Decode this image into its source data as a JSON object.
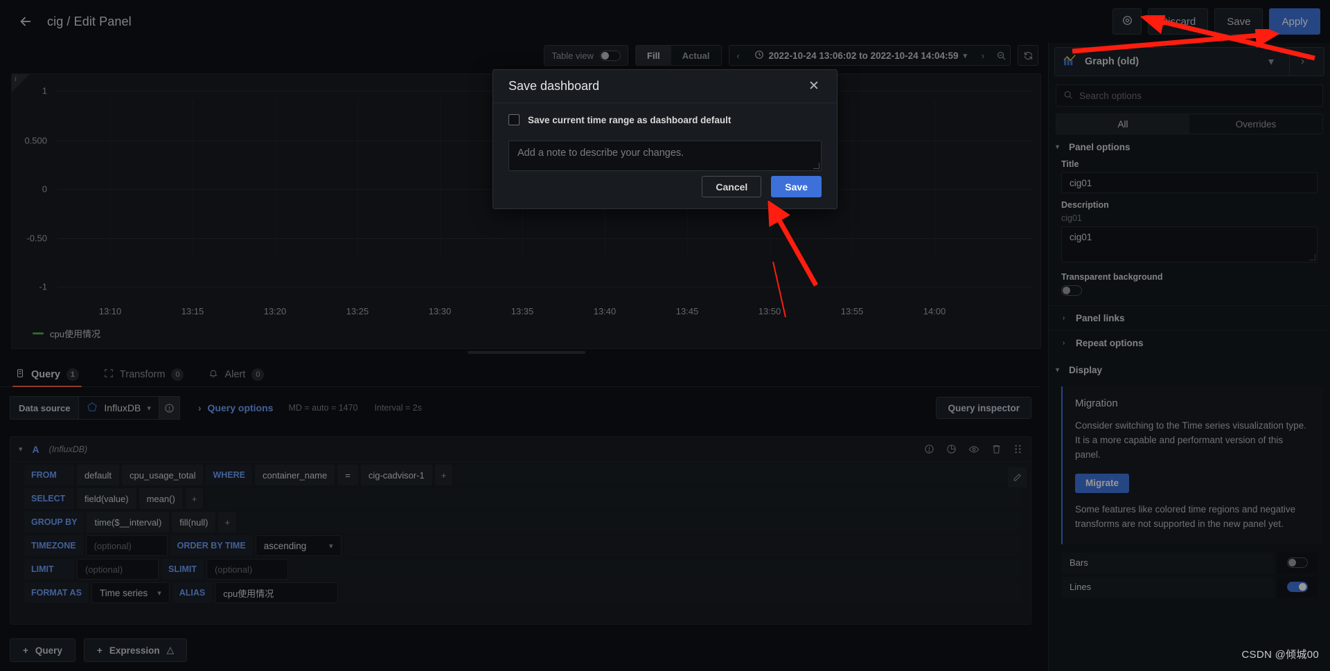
{
  "topbar": {
    "back_icon": "arrow-left-icon",
    "breadcrumb": "cig / Edit Panel",
    "settings_icon": "gear-icon",
    "discard_label": "Discard",
    "save_label": "Save",
    "apply_label": "Apply",
    "accent_primary": "#3d71d9"
  },
  "panel_toolbar": {
    "table_view_label": "Table view",
    "table_view_on": false,
    "fill_label": "Fill",
    "actual_label": "Actual",
    "active_scale": "Fill",
    "prev_icon": "chevron-left-icon",
    "clock_icon": "clock-icon",
    "time_range": "2022-10-24 13:06:02 to 2022-10-24 14:04:59",
    "caret_icon": "chevron-down-icon",
    "next_icon": "chevron-right-icon",
    "zoom_out_icon": "zoom-out-icon",
    "refresh_icon": "refresh-icon"
  },
  "graph": {
    "info_icon": "info-corner-icon",
    "resize_handle": "panel-resize-handle"
  },
  "chart_data": {
    "type": "line",
    "title": "",
    "xlabel": "",
    "ylabel": "",
    "series": [
      {
        "name": "cpu使用情况",
        "color": "#56a64b",
        "values": []
      }
    ],
    "x_ticks": [
      "13:10",
      "13:15",
      "13:20",
      "13:25",
      "13:30",
      "13:35",
      "13:40",
      "13:45",
      "13:50",
      "13:55",
      "14:00"
    ],
    "y_ticks": [
      "1",
      "0.500",
      "0",
      "-0.50",
      "-1"
    ],
    "ylim": [
      -1,
      1
    ],
    "grid": true,
    "legend_position": "bottom-left",
    "legend": [
      "cpu使用情况"
    ],
    "time_from": "2022-10-24 13:06:02",
    "time_to": "2022-10-24 14:04:59",
    "note": "No data points rendered in the plot area"
  },
  "editor_tabs": [
    {
      "label": "Query",
      "badge": "1",
      "icon": "database-icon",
      "active": true
    },
    {
      "label": "Transform",
      "badge": "0",
      "icon": "transform-icon",
      "active": false
    },
    {
      "label": "Alert",
      "badge": "0",
      "icon": "bell-icon",
      "active": false
    }
  ],
  "datasource_row": {
    "label": "Data source",
    "value": "InfluxDB",
    "ds_icon": "influxdb-icon",
    "caret_icon": "chevron-down-icon",
    "help_icon": "help-circle-icon",
    "query_options_label": "Query options",
    "expand_icon": "chevron-right-icon",
    "max_data_points": "MD = auto = 1470",
    "interval": "Interval = 2s",
    "query_inspector_label": "Query inspector"
  },
  "query_card": {
    "caret_icon": "chevron-down-icon",
    "ref_id": "A",
    "datasource": "(InfluxDB)",
    "icons": [
      "help-circle-icon",
      "duplicate-icon",
      "eye-icon",
      "trash-icon",
      "drag-handle-icon"
    ],
    "pencil_icon": "pencil-icon",
    "rows": [
      {
        "key": "FROM",
        "segments": [
          {
            "text": "default",
            "kind": "value"
          },
          {
            "text": "cpu_usage_total",
            "kind": "value"
          },
          {
            "text": "WHERE",
            "kind": "key"
          },
          {
            "text": "container_name",
            "kind": "value"
          },
          {
            "text": "=",
            "kind": "value"
          },
          {
            "text": "cig-cadvisor-1",
            "kind": "value"
          },
          {
            "text": "+",
            "kind": "plus"
          }
        ]
      },
      {
        "key": "SELECT",
        "segments": [
          {
            "text": "field(value)",
            "kind": "value"
          },
          {
            "text": "mean()",
            "kind": "value"
          },
          {
            "text": "+",
            "kind": "plus"
          }
        ]
      },
      {
        "key": "GROUP BY",
        "segments": [
          {
            "text": "time($__interval)",
            "kind": "value"
          },
          {
            "text": "fill(null)",
            "kind": "value"
          },
          {
            "text": "+",
            "kind": "plus"
          }
        ]
      },
      {
        "key": "TIMEZONE",
        "segments": [
          {
            "text": "(optional)",
            "kind": "input"
          },
          {
            "text": "ORDER BY TIME",
            "kind": "key"
          },
          {
            "text": "ascending",
            "kind": "select"
          }
        ]
      },
      {
        "key": "LIMIT",
        "segments": [
          {
            "text": "(optional)",
            "kind": "input"
          },
          {
            "text": "SLIMIT",
            "kind": "key"
          },
          {
            "text": "(optional)",
            "kind": "input"
          }
        ]
      },
      {
        "key": "FORMAT AS",
        "segments": [
          {
            "text": "Time series",
            "kind": "select"
          },
          {
            "text": "ALIAS",
            "kind": "key"
          },
          {
            "text": "cpu使用情况",
            "kind": "alias"
          }
        ]
      }
    ]
  },
  "bottom_buttons": [
    {
      "label": "Query",
      "icon": "plus-icon"
    },
    {
      "label": "Expression",
      "icon": "plus-icon",
      "suffix_icon": "alpha-icon"
    }
  ],
  "options_pane": {
    "viz_icon": "graph-icon",
    "viz_name": "Graph (old)",
    "viz_caret_icon": "chevron-down-icon",
    "viz_arrow_icon": "chevron-right-icon",
    "search_icon": "search-icon",
    "search_placeholder": "Search options",
    "tab_all": "All",
    "tab_overrides": "Overrides",
    "panel_options_label": "Panel options",
    "title_label": "Title",
    "title_value": "cig01",
    "description_label": "Description",
    "description_sub": "cig01",
    "description_value": "cig01",
    "transparent_label": "Transparent background",
    "transparent_on": false,
    "panel_links_label": "Panel links",
    "repeat_options_label": "Repeat options",
    "display_label": "Display",
    "migration": {
      "title": "Migration",
      "body_1": "Consider switching to the Time series visualization type. It is a more capable and performant version of this panel.",
      "button": "Migrate",
      "body_2": "Some features like colored time regions and negative transforms are not supported in the new panel yet."
    },
    "display_toggles": [
      {
        "label": "Bars",
        "on": false
      },
      {
        "label": "Lines",
        "on": true
      }
    ]
  },
  "modal": {
    "title": "Save dashboard",
    "close_icon": "close-icon",
    "checkbox_label": "Save current time range as dashboard default",
    "checkbox_checked": false,
    "note_placeholder": "Add a note to describe your changes.",
    "note_value": "",
    "cancel_label": "Cancel",
    "save_label": "Save"
  },
  "watermark": "CSDN @倾城00"
}
